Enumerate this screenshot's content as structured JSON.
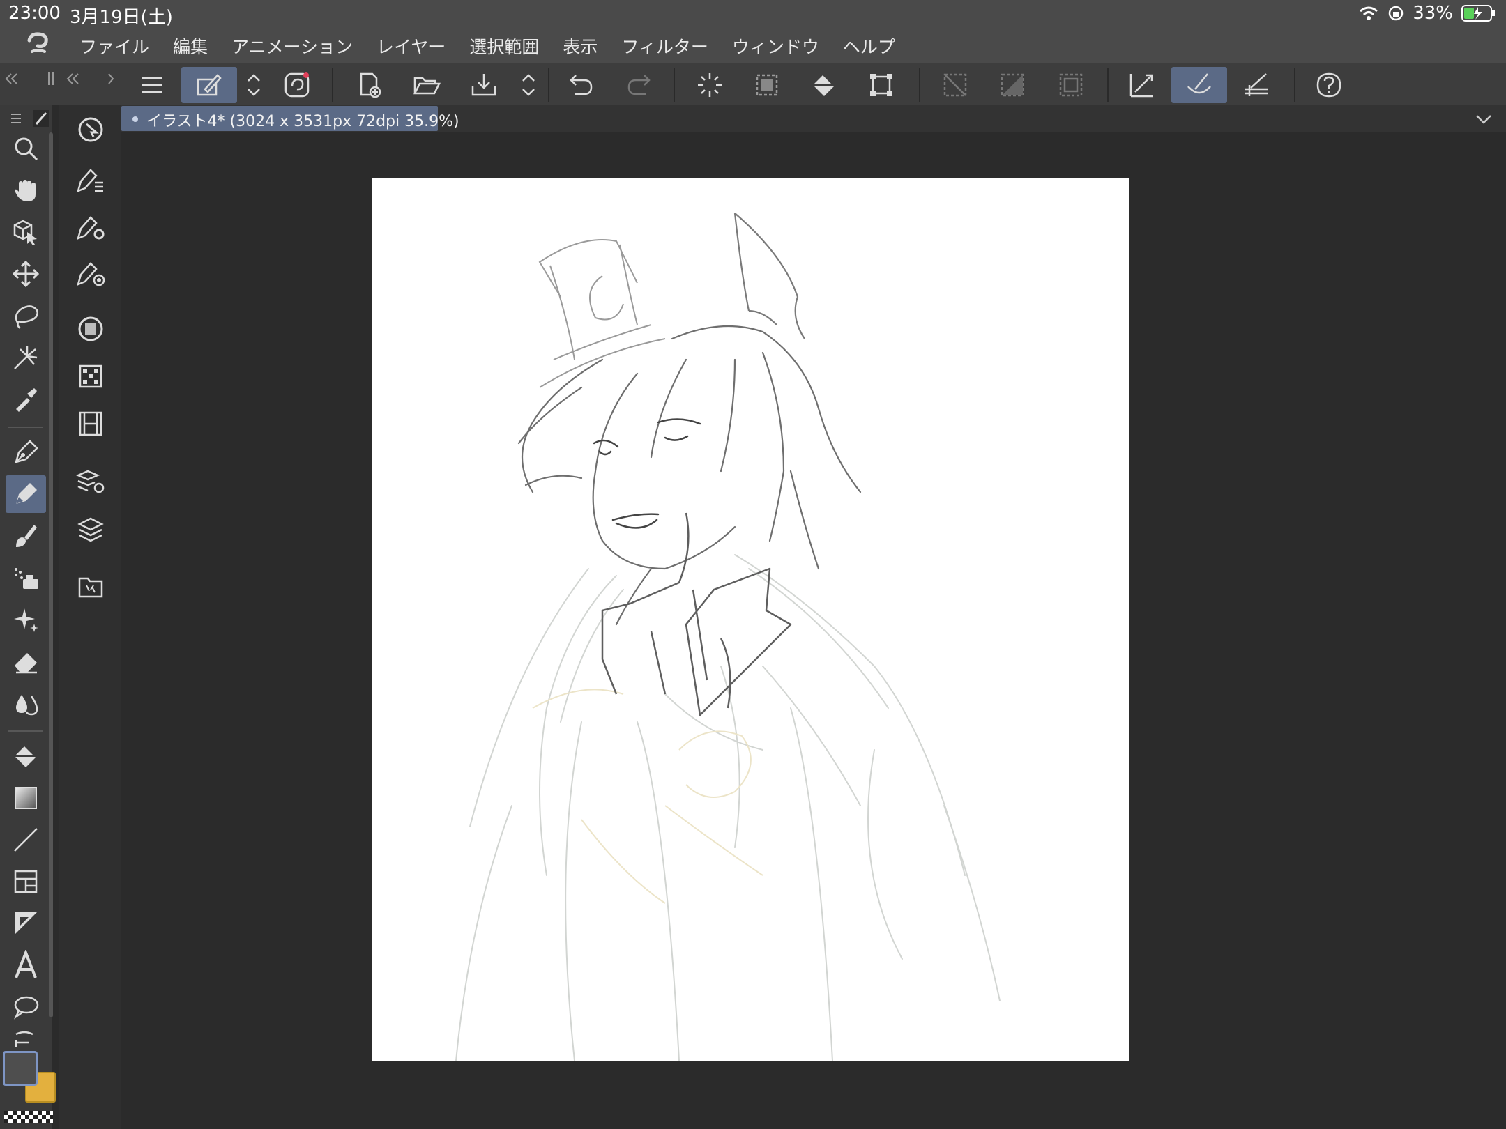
{
  "status": {
    "time": "23:00",
    "date": "3月19日(土)",
    "battery": "33%"
  },
  "menu": [
    "ファイル",
    "編集",
    "アニメーション",
    "レイヤー",
    "選択範囲",
    "表示",
    "フィルター",
    "ウィンドウ",
    "ヘルプ"
  ],
  "document": {
    "tab_title": "イラスト4* (3024 x 3531px 72dpi 35.9%)"
  },
  "colors": {
    "main": "#4e4e4e",
    "sub": "#e3b03e",
    "accent": "#5b6a86"
  },
  "tools": [
    "zoom-icon",
    "hand-icon",
    "object-icon",
    "move-icon",
    "lasso-select-icon",
    "auto-select-icon",
    "eyedropper-icon",
    "pen-icon",
    "pencil-icon",
    "brush-icon",
    "airbrush-icon",
    "decoration-icon",
    "eraser-icon",
    "blend-icon",
    "fill-icon",
    "gradient-icon",
    "line-icon",
    "frame-icon",
    "ruler-icon",
    "text-icon",
    "balloon-icon",
    "correct-line-icon"
  ]
}
